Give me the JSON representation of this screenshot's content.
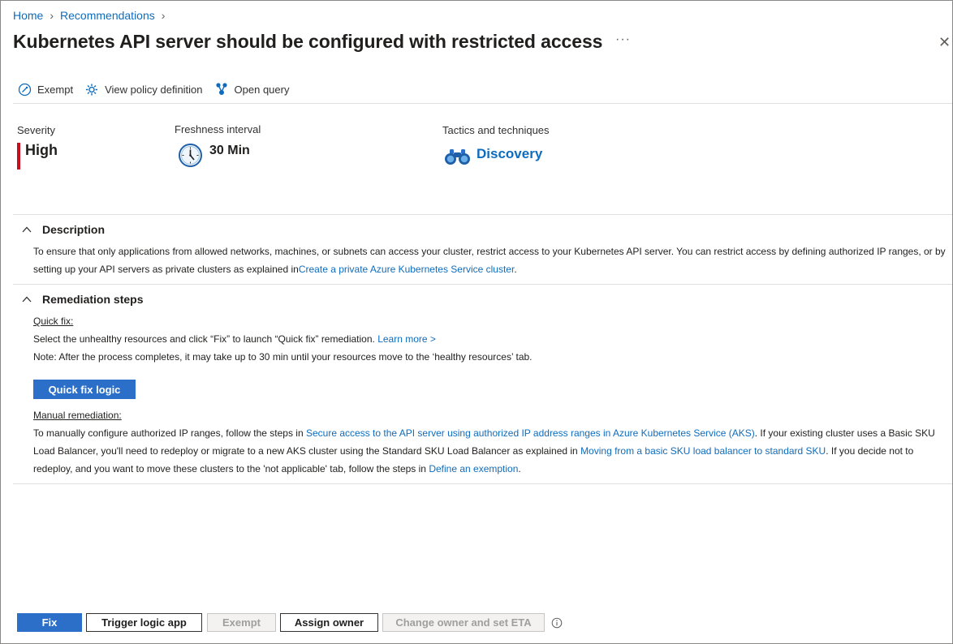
{
  "breadcrumb": {
    "home": "Home",
    "recommendations": "Recommendations"
  },
  "title": "Kubernetes API server should be configured with restricted access",
  "more_label": "···",
  "close_label": "✕",
  "toolbar": {
    "exempt": "Exempt",
    "view_policy": "View policy definition",
    "open_query": "Open query"
  },
  "stats": {
    "severity_label": "Severity",
    "severity_value": "High",
    "freshness_label": "Freshness interval",
    "freshness_value": "30 Min",
    "tactics_label": "Tactics and techniques",
    "tactics_value": "Discovery"
  },
  "description": {
    "heading": "Description",
    "text_1": "To ensure that only applications from allowed networks, machines, or subnets can access your cluster, restrict access to your Kubernetes API server. You can restrict access by defining authorized IP ranges, or by setting up your API servers as private clusters as explained in",
    "link": "Create a private Azure Kubernetes Service cluster",
    "text_2": "."
  },
  "remediation": {
    "heading": "Remediation steps",
    "quick_fix_label": "Quick fix:",
    "quick_fix_text": "Select the unhealthy resources and click “Fix” to launch “Quick fix” remediation.",
    "learn_more": "Learn more >",
    "note": "Note: After the process completes, it may take up to 30 min until your resources move to the ‘healthy resources’ tab.",
    "quick_fix_button": "Quick fix logic",
    "manual_label": "Manual remediation:",
    "manual_1": "To manually configure authorized IP ranges, follow the steps in",
    "manual_link_1": "Secure access to the API server using authorized IP address ranges in Azure Kubernetes Service (AKS)",
    "manual_2": ". If your existing cluster uses a Basic SKU Load Balancer, you'll need to redeploy or migrate to a new AKS cluster using the Standard SKU Load Balancer as explained in",
    "manual_link_2": "Moving from a basic SKU load balancer to standard SKU",
    "manual_3": ". If you decide not to redeploy, and you want to move these clusters to the 'not applicable' tab, follow the steps in",
    "manual_link_3": "Define an exemption",
    "manual_4": "."
  },
  "footer": {
    "fix": "Fix",
    "trigger": "Trigger logic app",
    "exempt": "Exempt",
    "assign": "Assign owner",
    "change": "Change owner and set ETA"
  },
  "colors": {
    "accent": "#2b6fc9",
    "link": "#0f6cbd",
    "severity_high": "#c50f1f"
  }
}
